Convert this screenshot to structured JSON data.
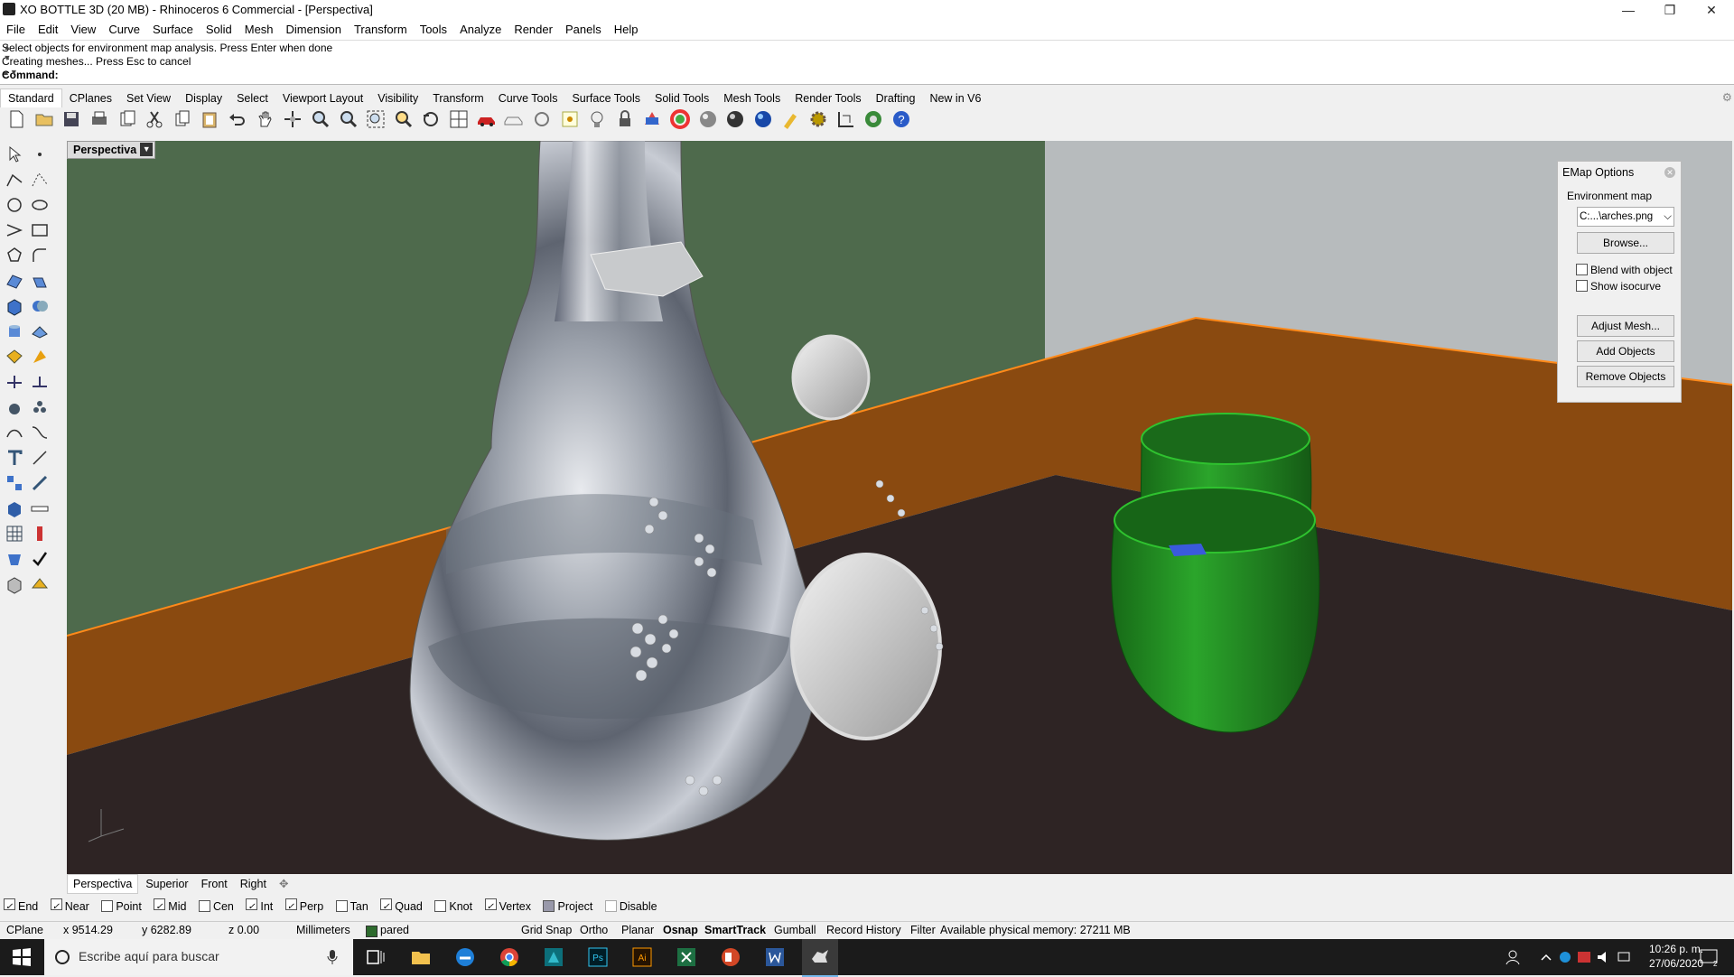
{
  "window": {
    "title": "XO BOTTLE 3D (20 MB) - Rhinoceros 6 Commercial - [Perspectiva]",
    "minimize": "—",
    "restore": "❐",
    "close": "✕"
  },
  "menu": [
    "File",
    "Edit",
    "View",
    "Curve",
    "Surface",
    "Solid",
    "Mesh",
    "Dimension",
    "Transform",
    "Tools",
    "Analyze",
    "Render",
    "Panels",
    "Help"
  ],
  "command": {
    "line1": "Select objects for environment map analysis. Press Enter when done",
    "line2": "Creating meshes... Press Esc to cancel",
    "prompt": "Command:"
  },
  "tabs": [
    "Standard",
    "CPlanes",
    "Set View",
    "Display",
    "Select",
    "Viewport Layout",
    "Visibility",
    "Transform",
    "Curve Tools",
    "Surface Tools",
    "Solid Tools",
    "Mesh Tools",
    "Render Tools",
    "Drafting",
    "New in V6"
  ],
  "viewport": {
    "label": "Perspectiva"
  },
  "emap": {
    "title": "EMap Options",
    "env_label": "Environment map",
    "env_value": "C:...\\arches.png",
    "browse": "Browse...",
    "blend": "Blend with object",
    "isocurve": "Show isocurve",
    "adjust": "Adjust Mesh...",
    "add": "Add Objects",
    "remove": "Remove Objects"
  },
  "viewport_tabs": [
    "Perspectiva",
    "Superior",
    "Front",
    "Right"
  ],
  "osnap": [
    {
      "label": "End",
      "checked": true
    },
    {
      "label": "Near",
      "checked": true
    },
    {
      "label": "Point",
      "checked": false
    },
    {
      "label": "Mid",
      "checked": true
    },
    {
      "label": "Cen",
      "checked": false
    },
    {
      "label": "Int",
      "checked": true
    },
    {
      "label": "Perp",
      "checked": true
    },
    {
      "label": "Tan",
      "checked": false
    },
    {
      "label": "Quad",
      "checked": true
    },
    {
      "label": "Knot",
      "checked": false
    },
    {
      "label": "Vertex",
      "checked": true
    },
    {
      "label": "Project",
      "checked": false
    },
    {
      "label": "Disable",
      "checked": false
    }
  ],
  "status": {
    "cplane": "CPlane",
    "x": "x 9514.29",
    "y": "y 6282.89",
    "z": "z 0.00",
    "units": "Millimeters",
    "layer": "pared",
    "layer_color": "#2e6b2e",
    "gridsnap": "Grid Snap",
    "ortho": "Ortho",
    "planar": "Planar",
    "osnap": "Osnap",
    "smarttrack": "SmartTrack",
    "gumball": "Gumball",
    "record": "Record History",
    "filter": "Filter",
    "memory": "Available physical memory: 27211 MB"
  },
  "taskbar": {
    "search_placeholder": "Escribe aquí para buscar",
    "time": "10:26 p. m.",
    "date": "27/06/2020",
    "notif_count": "2"
  },
  "colors": {
    "wall_green": "#4e6a4c",
    "wall_gray": "#b7bbbd",
    "trim_orange": "#8a4a10",
    "floor": "#2e2424",
    "cup_green": "#1f8a1f",
    "accent_blue": "#0078d7"
  }
}
